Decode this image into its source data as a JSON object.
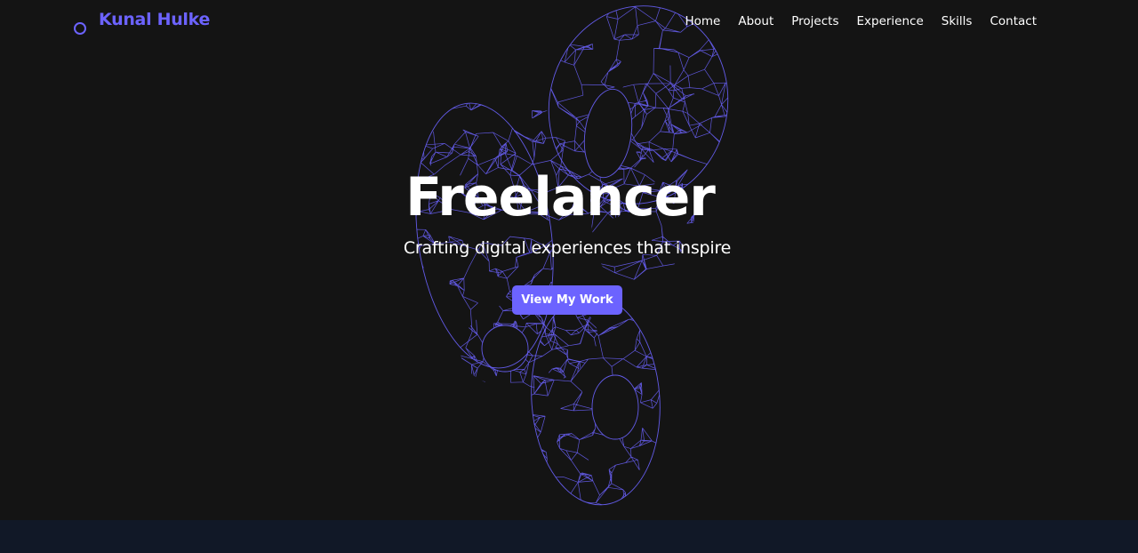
{
  "brand": {
    "name": "Kunal Hulke",
    "accent_color": "#6c63ff"
  },
  "nav": {
    "items": [
      "Home",
      "About",
      "Projects",
      "Experience",
      "Skills",
      "Contact"
    ]
  },
  "hero": {
    "title": "Freelancer",
    "subtitle": "Crafting digital experiences that inspire",
    "cta_label": "View My Work",
    "background_color": "#141414",
    "graphic": "wireframe-knot-3d"
  },
  "next_section": {
    "background_color": "#111827"
  }
}
